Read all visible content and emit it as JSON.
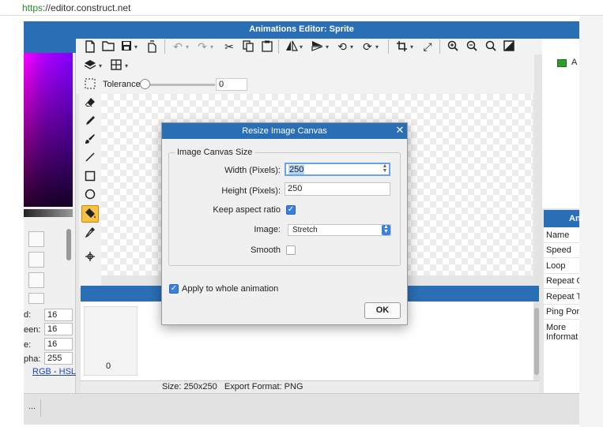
{
  "browser": {
    "url_scheme": "https",
    "url_rest": "://editor.construct.net"
  },
  "editor": {
    "title": "Animations Editor: Sprite"
  },
  "toolbar": {
    "tolerance_label": "Tolerance",
    "tolerance_value": "0",
    "tolerance_level": 0,
    "icons": [
      "new-file-icon",
      "open-folder-icon",
      "save-icon",
      "export-icon",
      "undo-icon",
      "redo-icon",
      "cut-icon",
      "copy-icon",
      "paste-icon",
      "flip-horizontal-icon",
      "flip-vertical-icon",
      "rotate-ccw-icon",
      "rotate-cw-icon",
      "crop-icon",
      "resize-icon",
      "zoom-in-icon",
      "zoom-out-icon",
      "zoom-reset-icon",
      "grid-toggle-icon",
      "layers-icon",
      "grid-icon"
    ]
  },
  "color_panel": {
    "fields": [
      {
        "label": "d:",
        "value": "16"
      },
      {
        "label": "een:",
        "value": "16"
      },
      {
        "label": "e:",
        "value": "16"
      },
      {
        "label": "pha:",
        "value": "255"
      }
    ],
    "rgb_link": "RGB",
    "dash": " - ",
    "hsl_link": "HSL"
  },
  "frames": {
    "first_frame_number": "0"
  },
  "status": {
    "text": "Size: 250x250   Export Format: PNG"
  },
  "right_panel": {
    "animation_chip_label": "A",
    "properties_header": "Ani",
    "properties": [
      "Name",
      "Speed",
      "Loop",
      "Repeat C",
      "Repeat T",
      "Ping Pon",
      "More",
      "Informat"
    ]
  },
  "bottom": {
    "dots_label": "..."
  },
  "dialog": {
    "title": "Resize Image Canvas",
    "close_glyph": "✕",
    "group_title": "Image Canvas Size",
    "width_label": "Width (Pixels):",
    "width_value": "250",
    "height_label": "Height (Pixels):",
    "height_value": "250",
    "keep_aspect_label": "Keep aspect ratio",
    "keep_aspect_checked": true,
    "image_label": "Image:",
    "image_value": "Stretch",
    "smooth_label": "Smooth",
    "smooth_checked": false,
    "apply_label": "Apply to whole animation",
    "apply_checked": true,
    "ok_label": "OK"
  },
  "colors": {
    "title_bar_blue": "#2a6fb5",
    "checkbox_blue": "#3b7fe0",
    "active_tool_yellow": "#f7c244"
  }
}
